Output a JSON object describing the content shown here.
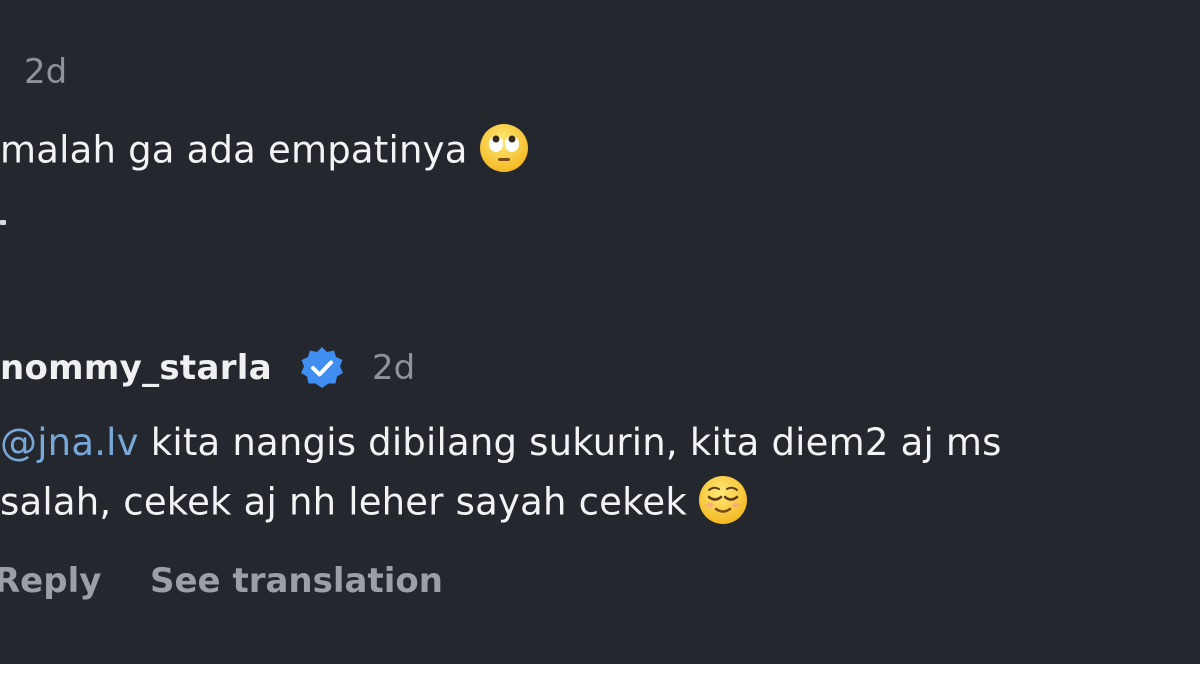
{
  "first_comment": {
    "time": "2d",
    "text": "malah ga ada empatinya",
    "emoji": "face-with-rolling-eyes"
  },
  "second_comment": {
    "username": "nommy_starla",
    "verified_icon": "verified-badge-icon",
    "time": "2d",
    "mention": "@jna.lv",
    "line1_rest": " kita nangis dibilang sukurin, kita diem2 aj ms",
    "line2": "salah, cekek aj nh leher sayah cekek",
    "emoji": "relieved-face",
    "actions": {
      "reply": "Reply",
      "see_translation": "See translation"
    }
  },
  "colors": {
    "background": "#24272d",
    "text": "#f2f3f5",
    "secondary": "#8e9299",
    "mention": "#78a8d8",
    "verified": "#3f8ef0"
  }
}
